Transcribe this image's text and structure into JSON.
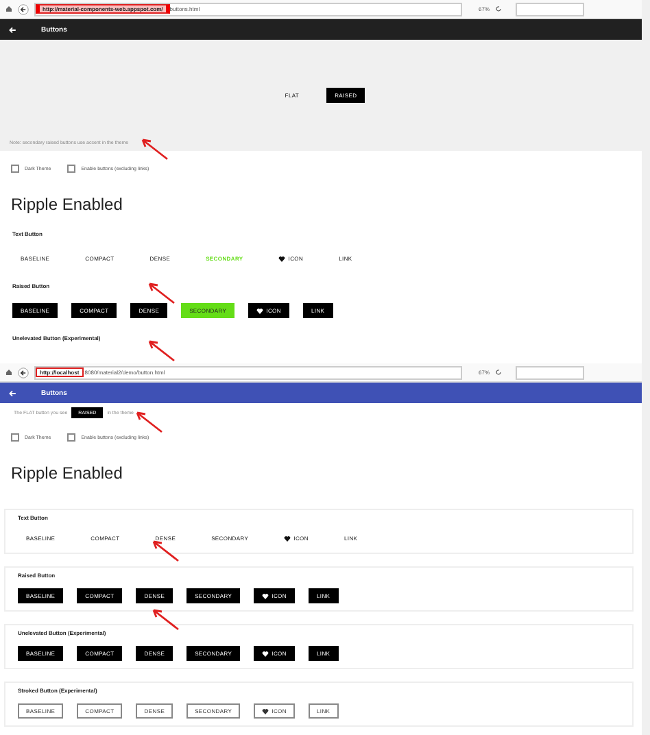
{
  "panels": [
    {
      "kind": "live",
      "address_marked": "http://material-components-web.appspot.com/",
      "address_rest": "buttons.html",
      "zoom": "67%",
      "app_bar": {
        "title": "Buttons",
        "color": "#212121"
      },
      "demo": {
        "buttons": [
          "FLAT",
          "RAISED"
        ],
        "note": "Note: secondary raised buttons use accent in the theme"
      },
      "checkboxes": [
        {
          "label": "Dark Theme",
          "checked": false
        },
        {
          "label": "Enable buttons (excluding links)",
          "checked": false
        }
      ],
      "heading": "Ripple Enabled",
      "sections": [
        {
          "title": "Text Button",
          "kind": "text",
          "buttons": [
            {
              "label": "BASELINE",
              "kind": "plain"
            },
            {
              "label": "COMPACT",
              "kind": "plain"
            },
            {
              "label": "DENSE",
              "kind": "plain"
            },
            {
              "label": "SECONDARY",
              "kind": "secondary",
              "color": "#64dd17"
            },
            {
              "label": "ICON",
              "kind": "icon"
            },
            {
              "label": "LINK",
              "kind": "plain"
            }
          ]
        },
        {
          "title": "Raised Button",
          "kind": "raised",
          "buttons": [
            {
              "label": "BASELINE",
              "kind": "plain"
            },
            {
              "label": "COMPACT",
              "kind": "plain"
            },
            {
              "label": "DENSE",
              "kind": "plain"
            },
            {
              "label": "SECONDARY",
              "kind": "secondary",
              "color": "#64dd17"
            },
            {
              "label": "ICON",
              "kind": "icon"
            },
            {
              "label": "LINK",
              "kind": "plain"
            }
          ]
        },
        {
          "title": "Unelevated Button (Experimental)"
        }
      ]
    },
    {
      "kind": "local",
      "address_marked": "http://localhost",
      "address_rest": ":8080/material2/demo/button.html",
      "zoom": "67%",
      "app_bar": {
        "title": "Buttons",
        "color": "#3f51b5"
      },
      "demo": {
        "note": "The FLAT button you see",
        "tooltip": "RAISED",
        "note_end": "in the theme"
      },
      "checkboxes": [
        {
          "label": "Dark Theme",
          "checked": false
        },
        {
          "label": "Enable buttons (excluding links)",
          "checked": false
        }
      ],
      "heading": "Ripple Enabled",
      "sections": [
        {
          "title": "Text Button",
          "kind": "text",
          "buttons": [
            {
              "label": "BASELINE",
              "kind": "plain"
            },
            {
              "label": "COMPACT",
              "kind": "plain"
            },
            {
              "label": "DENSE",
              "kind": "plain"
            },
            {
              "label": "SECONDARY",
              "kind": "secondary"
            },
            {
              "label": "ICON",
              "kind": "icon"
            },
            {
              "label": "LINK",
              "kind": "plain"
            }
          ]
        },
        {
          "title": "Raised Button",
          "kind": "raised",
          "buttons": [
            {
              "label": "BASELINE",
              "kind": "plain"
            },
            {
              "label": "COMPACT",
              "kind": "plain"
            },
            {
              "label": "DENSE",
              "kind": "plain"
            },
            {
              "label": "SECONDARY",
              "kind": "secondary"
            },
            {
              "label": "ICON",
              "kind": "icon"
            },
            {
              "label": "LINK",
              "kind": "plain"
            }
          ]
        },
        {
          "title": "Unelevated Button (Experimental)",
          "kind": "raised",
          "buttons": [
            {
              "label": "BASELINE",
              "kind": "plain"
            },
            {
              "label": "COMPACT",
              "kind": "plain"
            },
            {
              "label": "DENSE",
              "kind": "plain"
            },
            {
              "label": "SECONDARY",
              "kind": "secondary"
            },
            {
              "label": "ICON",
              "kind": "icon"
            },
            {
              "label": "LINK",
              "kind": "plain"
            }
          ]
        },
        {
          "title": "Stroked Button (Experimental)",
          "kind": "stroked",
          "buttons": [
            {
              "label": "BASELINE",
              "kind": "plain"
            },
            {
              "label": "COMPACT",
              "kind": "plain"
            },
            {
              "label": "DENSE",
              "kind": "plain"
            },
            {
              "label": "SECONDARY",
              "kind": "secondary"
            },
            {
              "label": "ICON",
              "kind": "icon"
            },
            {
              "label": "LINK",
              "kind": "plain"
            }
          ]
        }
      ]
    }
  ]
}
